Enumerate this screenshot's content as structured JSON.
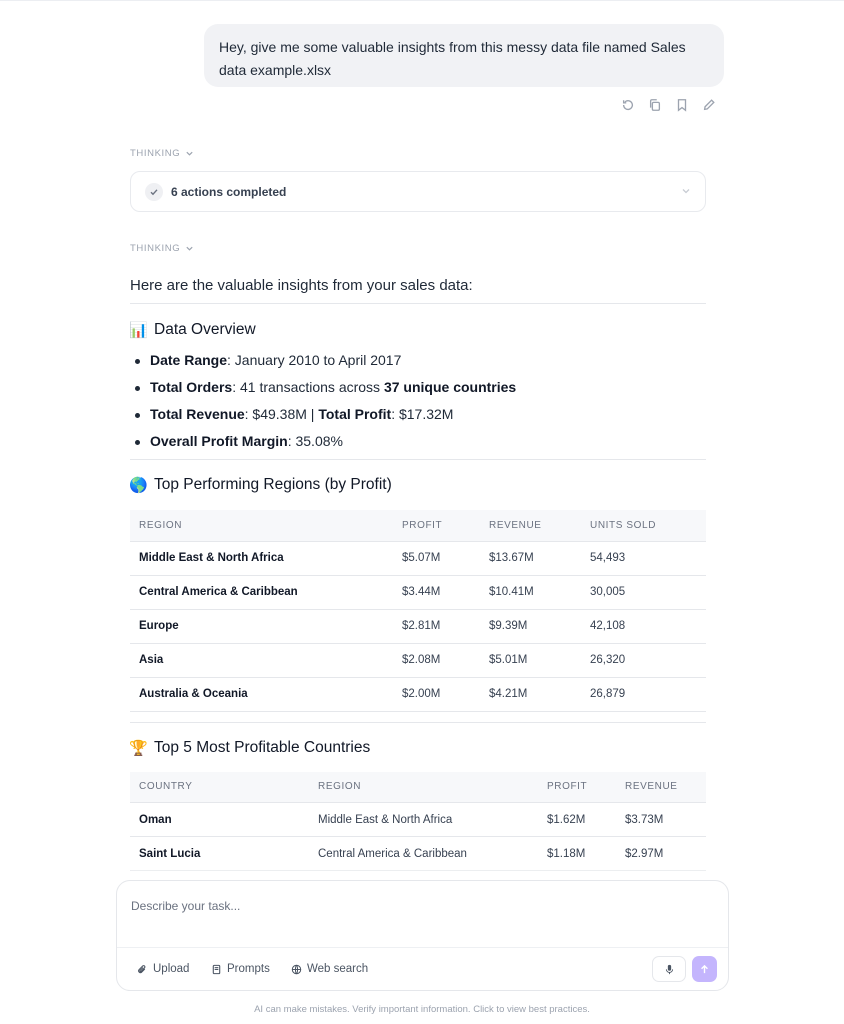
{
  "user_message": "Hey, give me some valuable insights from this messy data file named Sales data example.xlsx",
  "thinking_label": "THINKING",
  "actions_completed": "6 actions completed",
  "intro": "Here are the valuable insights from your sales data:",
  "overview": {
    "emoji": "📊",
    "title": "Data Overview",
    "date_range_label": "Date Range",
    "date_range_value": ": January 2010 to April 2017",
    "orders_label": "Total Orders",
    "orders_value": ": 41 transactions across ",
    "orders_countries": "37 unique countries",
    "revenue_label": "Total Revenue",
    "revenue_value": ": $49.38M | ",
    "profit_label": "Total Profit",
    "profit_value": ": $17.32M",
    "margin_label": "Overall Profit Margin",
    "margin_value": ": 35.08%"
  },
  "regions": {
    "emoji": "🌎",
    "title": "Top Performing Regions (by Profit)",
    "headers": [
      "REGION",
      "PROFIT",
      "REVENUE",
      "UNITS SOLD"
    ],
    "rows": [
      [
        "Middle East & North Africa",
        "$5.07M",
        "$13.67M",
        "54,493"
      ],
      [
        "Central America & Caribbean",
        "$3.44M",
        "$10.41M",
        "30,005"
      ],
      [
        "Europe",
        "$2.81M",
        "$9.39M",
        "42,108"
      ],
      [
        "Asia",
        "$2.08M",
        "$5.01M",
        "26,320"
      ],
      [
        "Australia & Oceania",
        "$2.00M",
        "$4.21M",
        "26,879"
      ]
    ]
  },
  "countries": {
    "emoji": "🏆",
    "title": "Top 5 Most Profitable Countries",
    "headers": [
      "COUNTRY",
      "REGION",
      "PROFIT",
      "REVENUE"
    ],
    "rows": [
      [
        "Oman",
        "Middle East & North Africa",
        "$1.62M",
        "$3.73M"
      ],
      [
        "Saint Lucia",
        "Central America & Caribbean",
        "$1.18M",
        "$2.97M"
      ]
    ]
  },
  "composer": {
    "placeholder": "Describe your task...",
    "upload": "Upload",
    "prompts": "Prompts",
    "web_search": "Web search"
  },
  "footer_note": "AI can make mistakes. Verify important information. Click to view best practices.",
  "colors": {
    "accent_send": "#c4b5fd",
    "bubble": "#f1f2f5"
  },
  "icons": [
    "retry-icon",
    "copy-icon",
    "bookmark-icon",
    "edit-icon",
    "chevron-down-icon",
    "check-icon",
    "paperclip-icon",
    "prompts-icon",
    "globe-icon",
    "mic-icon",
    "arrow-up-icon"
  ]
}
